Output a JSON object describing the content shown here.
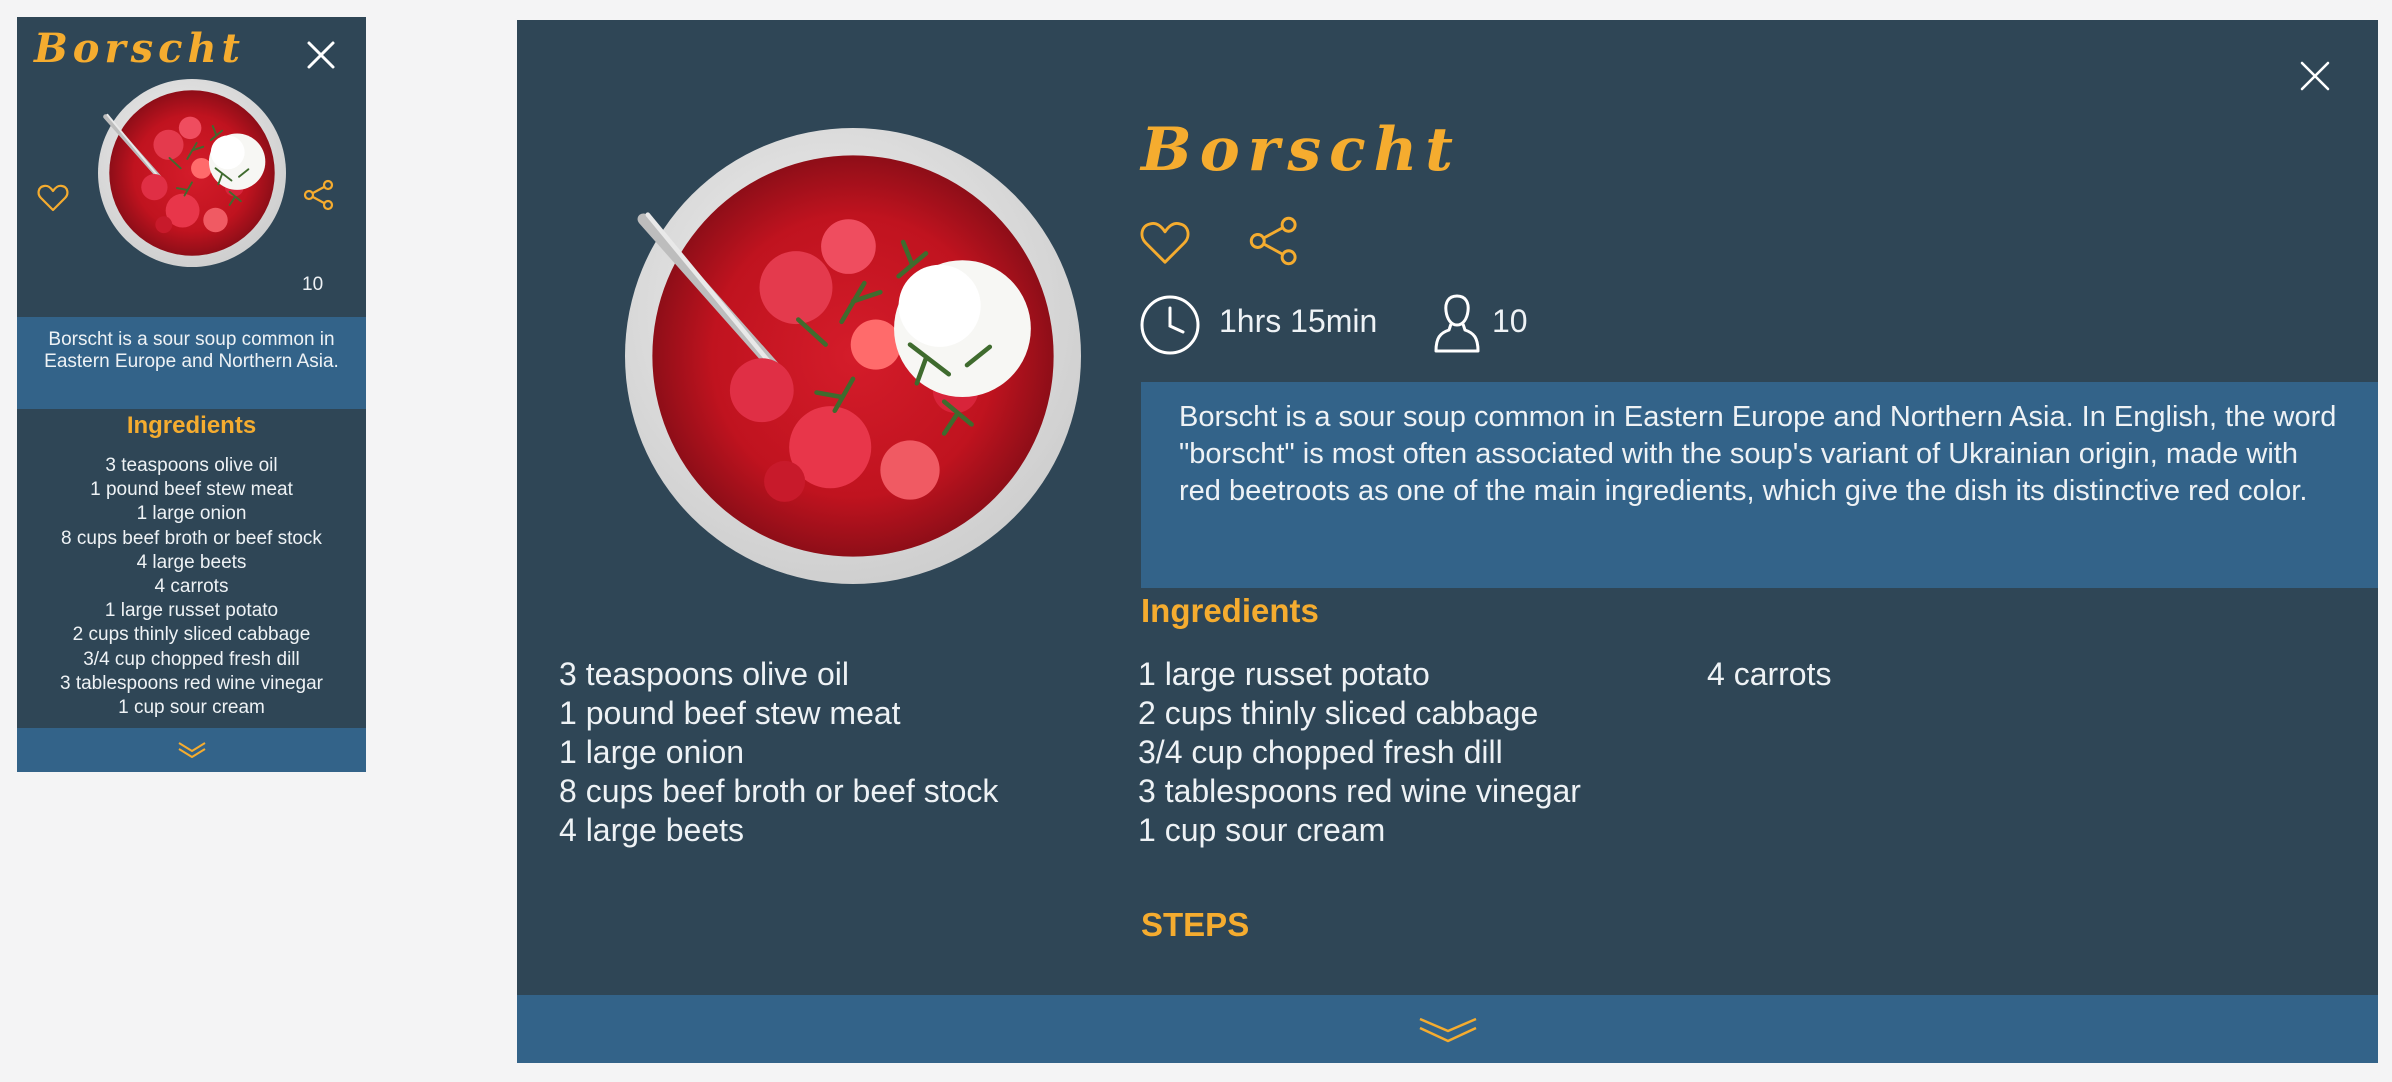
{
  "recipe": {
    "title": "Borscht",
    "cook_time": "1hrs 15min",
    "servings": "10",
    "description_short": "Borscht is a sour soup common in Eastern Europe and Northern Asia.",
    "description_full": "Borscht is a sour soup common in Eastern Europe and Northern Asia. In English, the word \"borscht\" is most often associated with the soup's variant of Ukrainian origin, made with red beetroots as one of the main ingredients, which give the dish its distinctive red color.",
    "ingredients_heading": "Ingredients",
    "steps_heading": "STEPS",
    "ingredients": [
      "3 teaspoons olive oil",
      "1 pound beef stew meat",
      "1 large onion",
      "8 cups beef broth or beef stock",
      "4 large beets",
      "4 carrots",
      "1 large russet potato",
      "2 cups thinly sliced cabbage",
      "3/4 cup chopped fresh dill",
      "3 tablespoons red wine vinegar",
      "1 cup sour cream"
    ],
    "desktop_columns": [
      [
        "3 teaspoons olive oil",
        "1 pound beef stew meat",
        "1 large onion",
        "8 cups beef broth or beef stock",
        "4 large beets"
      ],
      [
        "1 large russet potato",
        "2 cups thinly sliced cabbage",
        "3/4 cup chopped fresh dill",
        "3 tablespoons red wine vinegar",
        "1 cup sour cream"
      ],
      [
        "4 carrots"
      ]
    ]
  },
  "icons": {
    "close": "close-icon",
    "favorite": "heart-icon",
    "share": "share-icon",
    "time": "clock-icon",
    "servings": "person-icon",
    "expand": "chevron-down-icon"
  },
  "colors": {
    "page_background": "#f4f4f5",
    "card_background": "#2f4656",
    "band_blue": "#336389",
    "accent_orange": "#f5ac2f",
    "text_light": "#eef2f5"
  }
}
